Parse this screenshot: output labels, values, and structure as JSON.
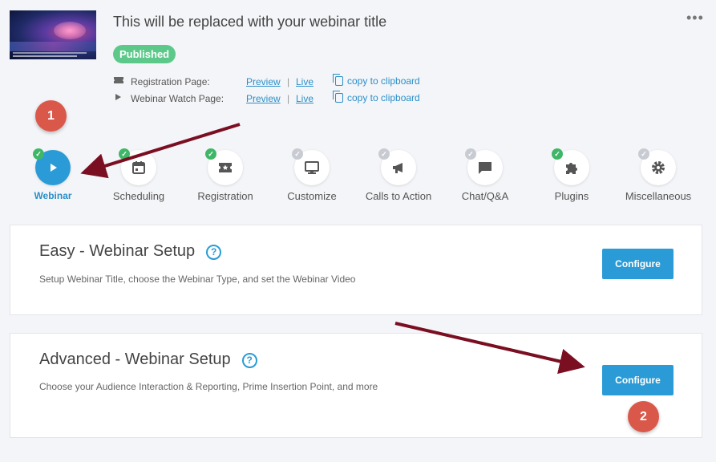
{
  "webinar": {
    "title": "This will be replaced with your webinar title",
    "status": "Published",
    "more_icon": "more-dots-icon"
  },
  "links": [
    {
      "icon": "ticket-icon",
      "label": "Registration Page:",
      "preview": "Preview",
      "separator": "|",
      "live": "Live",
      "copy": "copy to clipboard"
    },
    {
      "icon": "play-icon",
      "label": "Webinar Watch Page:",
      "preview": "Preview",
      "separator": "|",
      "live": "Live",
      "copy": "copy to clipboard"
    }
  ],
  "markers": [
    "1",
    "2"
  ],
  "steps": [
    {
      "label": "Webinar",
      "icon": "play-icon",
      "done": true,
      "active": true
    },
    {
      "label": "Scheduling",
      "icon": "calendar-icon",
      "done": true,
      "active": false
    },
    {
      "label": "Registration",
      "icon": "ticket-icon",
      "done": true,
      "active": false
    },
    {
      "label": "Customize",
      "icon": "monitor-icon",
      "done": false,
      "active": false
    },
    {
      "label": "Calls to Action",
      "icon": "megaphone-icon",
      "done": false,
      "active": false
    },
    {
      "label": "Chat/Q&A",
      "icon": "chat-icon",
      "done": false,
      "active": false
    },
    {
      "label": "Plugins",
      "icon": "puzzle-icon",
      "done": true,
      "active": false
    },
    {
      "label": "Miscellaneous",
      "icon": "gear-icon",
      "done": false,
      "active": false
    }
  ],
  "cards": [
    {
      "title": "Easy - Webinar Setup",
      "help": "?",
      "description": "Setup Webinar Title, choose the Webinar Type, and set the Webinar Video",
      "button": "Configure"
    },
    {
      "title": "Advanced - Webinar Setup",
      "help": "?",
      "description": "Choose your Audience Interaction & Reporting, Prime Insertion Point, and more",
      "button": "Configure"
    }
  ],
  "colors": {
    "accent": "#2a9bd6",
    "success": "#3fb768",
    "published": "#5cc98a",
    "marker": "#d9584a",
    "arrow": "#7a0f22"
  }
}
